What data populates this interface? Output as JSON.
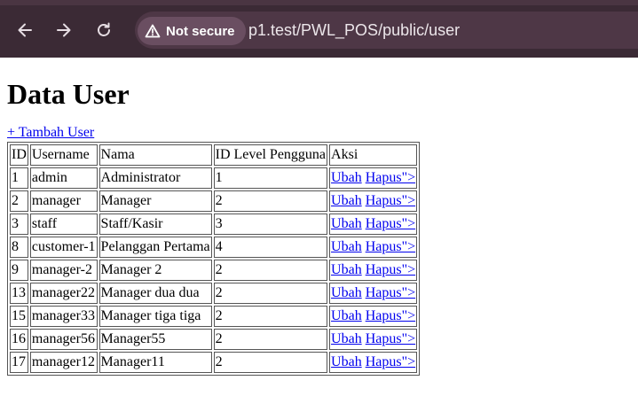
{
  "browser": {
    "back_icon": "arrow-left-icon",
    "forward_icon": "arrow-right-icon",
    "reload_icon": "reload-icon",
    "security_label": "Not secure",
    "url": "p1.test/PWL_POS/public/user"
  },
  "page": {
    "title": "Data User",
    "add_link": "+ Tambah User"
  },
  "table": {
    "headers": [
      "ID",
      "Username",
      "Nama",
      "ID Level Pengguna",
      "Aksi"
    ],
    "edit_label": "Ubah",
    "delete_label": "Hapus\">",
    "rows": [
      {
        "id": "1",
        "username": "admin",
        "nama": "Administrator",
        "level": "1"
      },
      {
        "id": "2",
        "username": "manager",
        "nama": "Manager",
        "level": "2"
      },
      {
        "id": "3",
        "username": "staff",
        "nama": "Staff/Kasir",
        "level": "3"
      },
      {
        "id": "8",
        "username": "customer-1",
        "nama": "Pelanggan Pertama",
        "level": "4"
      },
      {
        "id": "9",
        "username": "manager-2",
        "nama": "Manager 2",
        "level": "2"
      },
      {
        "id": "13",
        "username": "manager22",
        "nama": "Manager dua dua",
        "level": "2"
      },
      {
        "id": "15",
        "username": "manager33",
        "nama": "Manager tiga tiga",
        "level": "2"
      },
      {
        "id": "16",
        "username": "manager56",
        "nama": "Manager55",
        "level": "2"
      },
      {
        "id": "17",
        "username": "manager12",
        "nama": "Manager11",
        "level": "2"
      }
    ]
  }
}
